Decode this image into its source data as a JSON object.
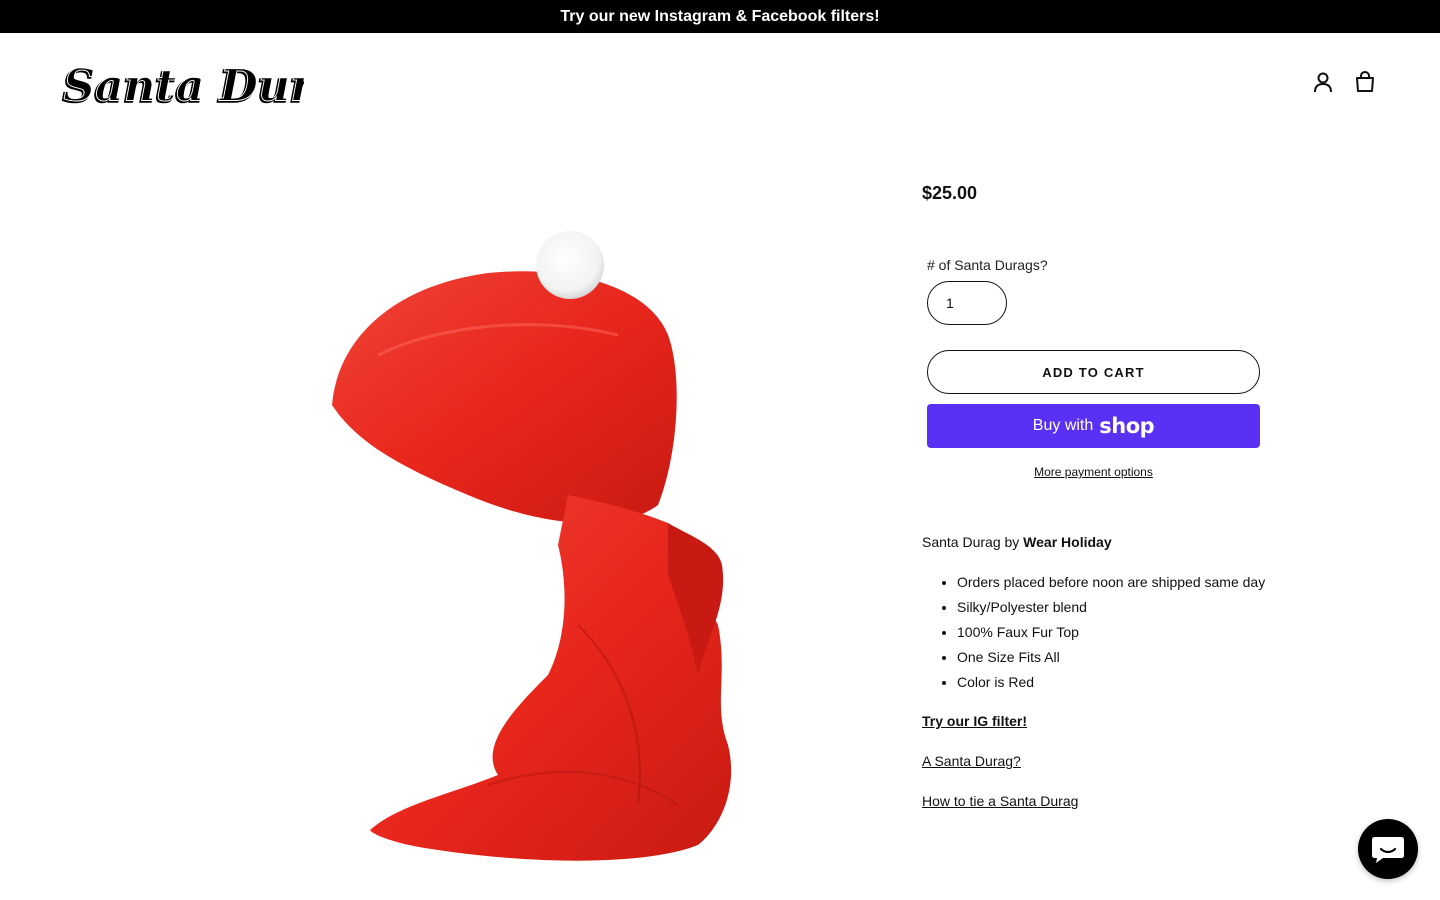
{
  "announcement": {
    "text": "Try our new Instagram & Facebook filters!"
  },
  "header": {
    "logo_text": "Santa Durag",
    "icons": [
      "user-icon",
      "cart-icon"
    ]
  },
  "product": {
    "price": "$25.00",
    "quantity_label": "# of Santa Durags?",
    "quantity_value": "1",
    "add_to_cart_label": "ADD TO CART",
    "buy_with_label": "Buy with",
    "shop_label": "shop",
    "more_payment_label": "More payment options",
    "description_prefix": "Santa Durag by ",
    "description_brand": "Wear Holiday",
    "features": [
      "Orders placed before noon are shipped same day",
      "Silky/Polyester blend",
      "100% Faux Fur Top",
      "One Size Fits All",
      "Color is Red"
    ],
    "links": {
      "ig_filter": "Try our IG filter!",
      "what_is": "A Santa Durag?",
      "how_to_tie": "How to tie a Santa Durag"
    }
  },
  "chat": {
    "icon": "chat-icon"
  },
  "colors": {
    "announcement_bg": "#000000",
    "shop_button": "#5a31f4",
    "durag_red": "#e8261c"
  }
}
